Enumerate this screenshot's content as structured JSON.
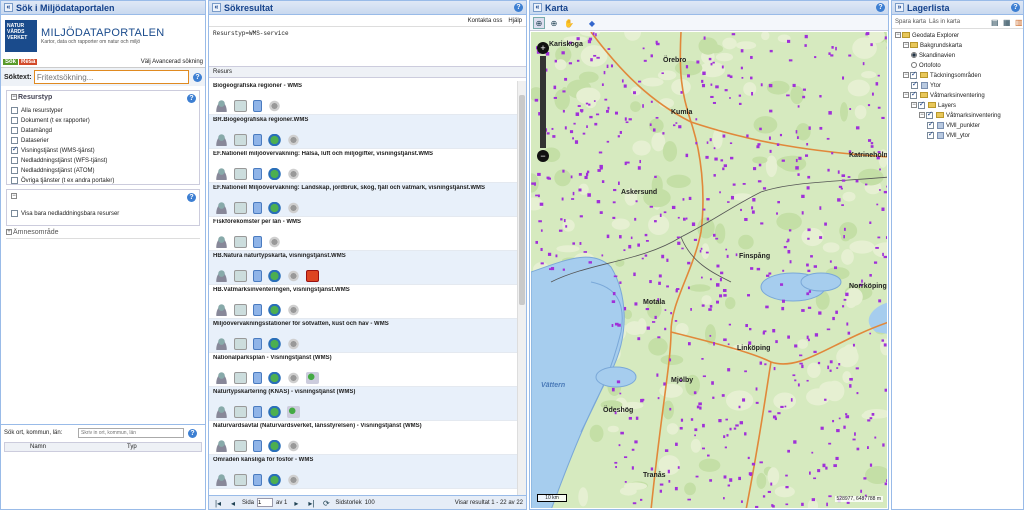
{
  "left": {
    "title": "Sök i Miljödataportalen",
    "logo_text": "NATUR VÅRDS VERKET",
    "brand": "MILJÖDATAPORTALEN",
    "tagline": "Kartor, data och rapporter om natur och miljö",
    "tab_search": "Sök",
    "tab_travel": "Resa",
    "advanced": "Välj Avancerad sökning",
    "search_label": "Söktext:",
    "search_placeholder": "Fritextsökning...",
    "resource_header": "Resurstyp",
    "resource_types": [
      {
        "label": "Alla resurstyper",
        "checked": false
      },
      {
        "label": "Dokument (t ex rapporter)",
        "checked": false
      },
      {
        "label": "Datamängd",
        "checked": false
      },
      {
        "label": "Dataserier",
        "checked": false
      },
      {
        "label": "Visningstjänst (WMS-tjänst)",
        "checked": true
      },
      {
        "label": "Nedladdningstjänst (WFS-tjänst)",
        "checked": false
      },
      {
        "label": "Nedladdningstjänst (ATOM)",
        "checked": false
      },
      {
        "label": "Övriga tjänster (t ex andra portaler)",
        "checked": false
      }
    ],
    "download_only": "Visa bara nedladdningsbara resurser",
    "subject_header": "Ämnesområde",
    "place_label": "Sök ort, kommun, län:",
    "place_placeholder": "Skriv in ort, kommun, län",
    "col_name": "Namn",
    "col_type": "Typ"
  },
  "results": {
    "title": "Sökresultat",
    "contact": "Kontakta oss",
    "help": "Hjälp",
    "query": "Resurstyp=WMS-service",
    "col": "Resurs",
    "items": [
      {
        "title": "Biogeografiska regioner - WMS",
        "icons": [
          "person",
          "map",
          "doc",
          "gear"
        ]
      },
      {
        "title": "BR.Biogeografiska regioner.WMS",
        "icons": [
          "person",
          "map",
          "doc",
          "globe",
          "gear"
        ]
      },
      {
        "title": "EF.Nationell miljöövervakning: Hälsa, luft och miljögifter, visningstjänst.WMS",
        "icons": [
          "person",
          "map",
          "doc",
          "globe",
          "gear"
        ]
      },
      {
        "title": "EF.Nationell Miljöövervakning: Landskap, jordbruk, skog, fjäll och våtmark, visningstjänst.WMS",
        "icons": [
          "person",
          "map",
          "doc",
          "globe",
          "gear"
        ]
      },
      {
        "title": "Fiskförekomster per län - WMS",
        "icons": [
          "person",
          "map",
          "doc",
          "gear"
        ]
      },
      {
        "title": "HB.Natura naturtypskarta, visningstjänst.WMS",
        "icons": [
          "person",
          "map",
          "doc",
          "globe",
          "gear",
          "pdf"
        ]
      },
      {
        "title": "HB.Våtmarksinventeringen, visningstjänst.WMS",
        "icons": [
          "person",
          "map",
          "doc",
          "globe",
          "gear"
        ]
      },
      {
        "title": "Miljöövervakningsstationer för sötvatten, kust och hav - WMS",
        "icons": [
          "person",
          "map",
          "doc",
          "globe",
          "gear"
        ]
      },
      {
        "title": "Nationalparksplan - Visningstjänst (WMS)",
        "icons": [
          "person",
          "map",
          "doc",
          "globe",
          "gear",
          "dl"
        ]
      },
      {
        "title": "Naturtypskartering (KNAS) - visningstjänst (WMS)",
        "icons": [
          "person",
          "map",
          "doc",
          "globe",
          "dl"
        ]
      },
      {
        "title": "Naturvårdsavtal (Naturvårdsverket, länsstyrelsen) - Visningstjänst (WMS)",
        "icons": [
          "person",
          "map",
          "doc",
          "globe",
          "gear"
        ]
      },
      {
        "title": "Områden känsliga för fosfor - WMS",
        "icons": [
          "person",
          "map",
          "doc",
          "globe",
          "gear"
        ]
      }
    ],
    "page_label": "Sida",
    "page": "1",
    "of": "av 1",
    "pagesize_label": "Sidstorlek",
    "pagesize": "100",
    "showing": "Visar resultat 1 - 22 av 22"
  },
  "map": {
    "title": "Karta",
    "scale": "10 km",
    "coords": "528977, 6487788 m",
    "places": [
      "Kariskoga",
      "Örebro",
      "Kumla",
      "Katrineholm",
      "Askersund",
      "Finspång",
      "Norrköping",
      "Motala",
      "Linköping",
      "Mjölby",
      "Vättern",
      "Tranås",
      "Ödeshög"
    ]
  },
  "layers": {
    "title": "Lagerlista",
    "save": "Spara karta",
    "read": "Läs in karta",
    "tree": [
      {
        "label": "Geodata Explorer",
        "level": 0,
        "kind": "folder"
      },
      {
        "label": "Bakgrundskarta",
        "level": 1,
        "kind": "folder"
      },
      {
        "label": "Skandinavien",
        "level": 2,
        "kind": "radio-on"
      },
      {
        "label": "Ortofoto",
        "level": 2,
        "kind": "radio"
      },
      {
        "label": "Täckningsområden",
        "level": 1,
        "kind": "folder-check"
      },
      {
        "label": "Ytor",
        "level": 2,
        "kind": "layer-check"
      },
      {
        "label": "Våtmarksinventering",
        "level": 1,
        "kind": "folder-check"
      },
      {
        "label": "Layers",
        "level": 2,
        "kind": "folder-check"
      },
      {
        "label": "Våtmarksinventering",
        "level": 3,
        "kind": "folder-check"
      },
      {
        "label": "VMI_punkter",
        "level": 4,
        "kind": "layer-check"
      },
      {
        "label": "VMI_ytor",
        "level": 4,
        "kind": "layer-check"
      }
    ]
  }
}
